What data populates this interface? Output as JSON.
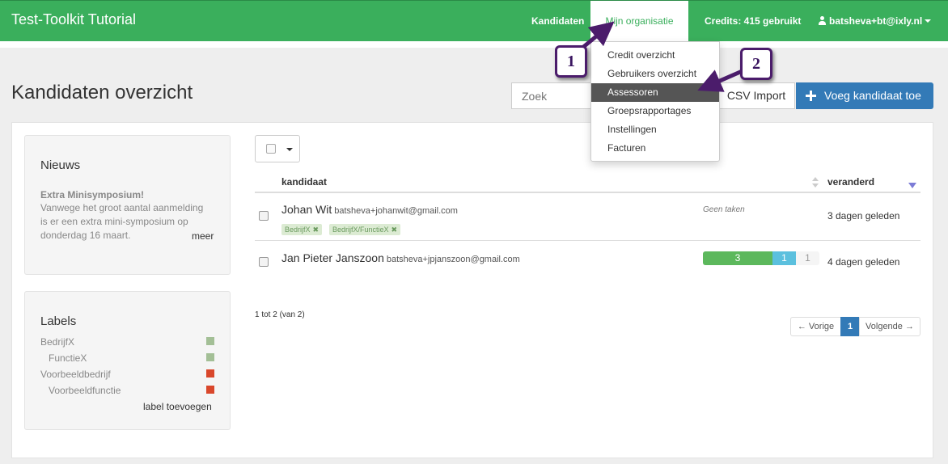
{
  "app": {
    "title": "Test-Toolkit Tutorial"
  },
  "nav": {
    "kandidaten": "Kandidaten",
    "mijn_organisatie": "Mijn organisatie",
    "credits": "Credits: 415 gebruikt",
    "user": "batsheva+bt@ixly.nl"
  },
  "dropdown": {
    "items": [
      {
        "label": "Credit overzicht",
        "active": false
      },
      {
        "label": "Gebruikers overzicht",
        "active": false
      },
      {
        "label": "Assessoren",
        "active": true
      },
      {
        "label": "Groepsrapportages",
        "active": false
      },
      {
        "label": "Instellingen",
        "active": false
      },
      {
        "label": "Facturen",
        "active": false
      }
    ]
  },
  "page": {
    "title": "Kandidaten overzicht",
    "search_placeholder": "Zoek",
    "csv_label": "CSV Import",
    "add_label": "Voeg kandidaat toe"
  },
  "news": {
    "title": "Nieuws",
    "headline": "Extra Minisymposium!",
    "body": "Vanwege het groot aantal aanmelding is er een extra mini-symposium op donderdag 16 maart.",
    "more": "meer"
  },
  "labels": {
    "title": "Labels",
    "items": [
      {
        "name": "BedrijfX",
        "color": "#a3bf96"
      },
      {
        "name": "FunctieX",
        "color": "#a3bf96"
      },
      {
        "name": "Voorbeeldbedrijf",
        "color": "#d9472b"
      },
      {
        "name": "Voorbeeldfunctie",
        "color": "#d9472b"
      }
    ],
    "add": "label toevoegen"
  },
  "table": {
    "col_candidate": "kandidaat",
    "col_changed": "veranderd",
    "rows": [
      {
        "name": "Johan Wit",
        "email": "batsheva+johanwit@gmail.com",
        "tags": [
          "BedrijfX",
          "BedrijfX/FunctieX"
        ],
        "tasks": "Geen taken",
        "changed": "3 dagen geleden"
      },
      {
        "name": "Jan Pieter Janszoon",
        "email": "batsheva+jpjanszoon@gmail.com",
        "progress": {
          "done": "3",
          "active": "1",
          "open": "1"
        },
        "changed": "4 dagen geleden"
      }
    ],
    "count": "1 tot 2 (van 2)"
  },
  "pagination": {
    "prev": "← Vorige",
    "current": "1",
    "next": "Volgende →"
  },
  "callouts": {
    "one": "1",
    "two": "2"
  },
  "colors": {
    "brand": "#3aaf5c",
    "primary": "#337ab7",
    "annotation": "#4b1c6b"
  }
}
